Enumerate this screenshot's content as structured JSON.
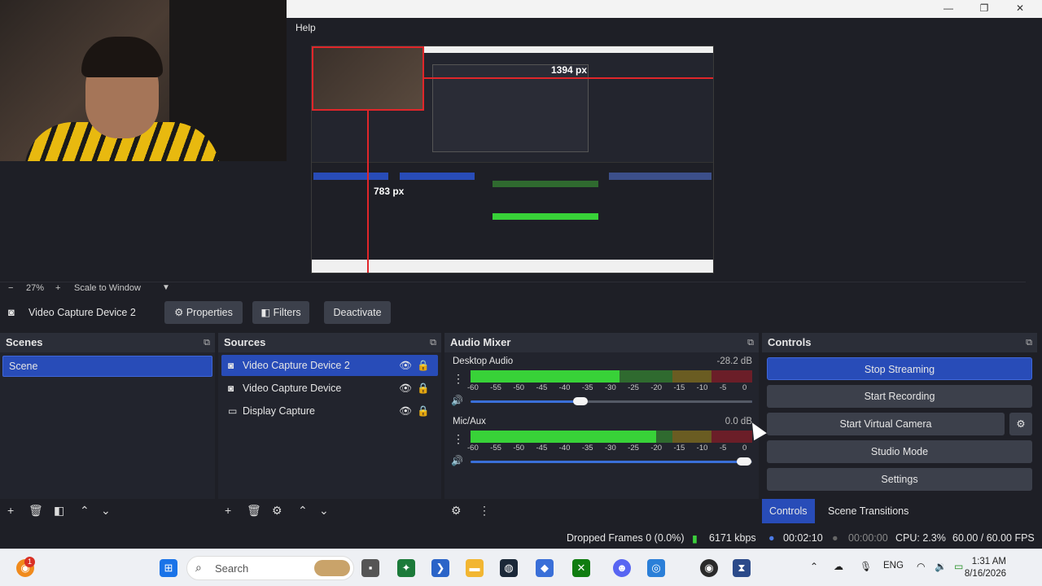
{
  "window": {
    "menu_help": "Help",
    "minimize": "—",
    "maximize": "❐",
    "close": "✕"
  },
  "preview": {
    "measure_horizontal": "1394 px",
    "measure_vertical": "783 px",
    "zoom_minus": "−",
    "zoom_level": "27%",
    "zoom_plus": "+",
    "scale_mode": "Scale to Window",
    "scale_dropdown": "▼"
  },
  "source_toolbar": {
    "source_name": "Video Capture Device 2",
    "properties": "Properties",
    "filters": "Filters",
    "deactivate": "Deactivate"
  },
  "scenes": {
    "title": "Scenes",
    "items": [
      "Scene"
    ]
  },
  "sources": {
    "title": "Sources",
    "items": [
      {
        "label": "Video Capture Device 2",
        "icon": "camera-icon"
      },
      {
        "label": "Video Capture Device",
        "icon": "camera-icon"
      },
      {
        "label": "Display Capture",
        "icon": "monitor-icon"
      }
    ]
  },
  "audio_mixer": {
    "title": "Audio Mixer",
    "ticks": [
      "-60",
      "-55",
      "-50",
      "-45",
      "-40",
      "-35",
      "-30",
      "-25",
      "-20",
      "-15",
      "-10",
      "-5",
      "0"
    ],
    "channels": [
      {
        "name": "Desktop Audio",
        "db": "-28.2 dB",
        "level": 0.53,
        "volume": 0.39
      },
      {
        "name": "Mic/Aux",
        "db": "0.0 dB",
        "level": 0.66,
        "volume": 0.97
      }
    ]
  },
  "controls": {
    "title": "Controls",
    "stop_streaming": "Stop Streaming",
    "start_recording": "Start Recording",
    "start_virtual_camera": "Start Virtual Camera",
    "studio_mode": "Studio Mode",
    "settings": "Settings",
    "tab_controls": "Controls",
    "tab_scene_transitions": "Scene Transitions"
  },
  "status": {
    "dropped_frames": "Dropped Frames 0 (0.0%)",
    "bitrate": "6171 kbps",
    "stream_time": "00:02:10",
    "record_time": "00:00:00",
    "cpu": "CPU: 2.3%",
    "fps": "60.00 / 60.00 FPS"
  },
  "taskbar": {
    "search_placeholder": "Search",
    "notification_badge": "1",
    "language": "ENG",
    "time": "1:31 AM",
    "date": "8/16/2026"
  },
  "colors": {
    "accent": "#284cb8",
    "panel": "#22242d",
    "button": "#3c404b",
    "meter_green": "#38d238",
    "meter_red": "#6b1e28",
    "red_guides": "#e0262a"
  }
}
